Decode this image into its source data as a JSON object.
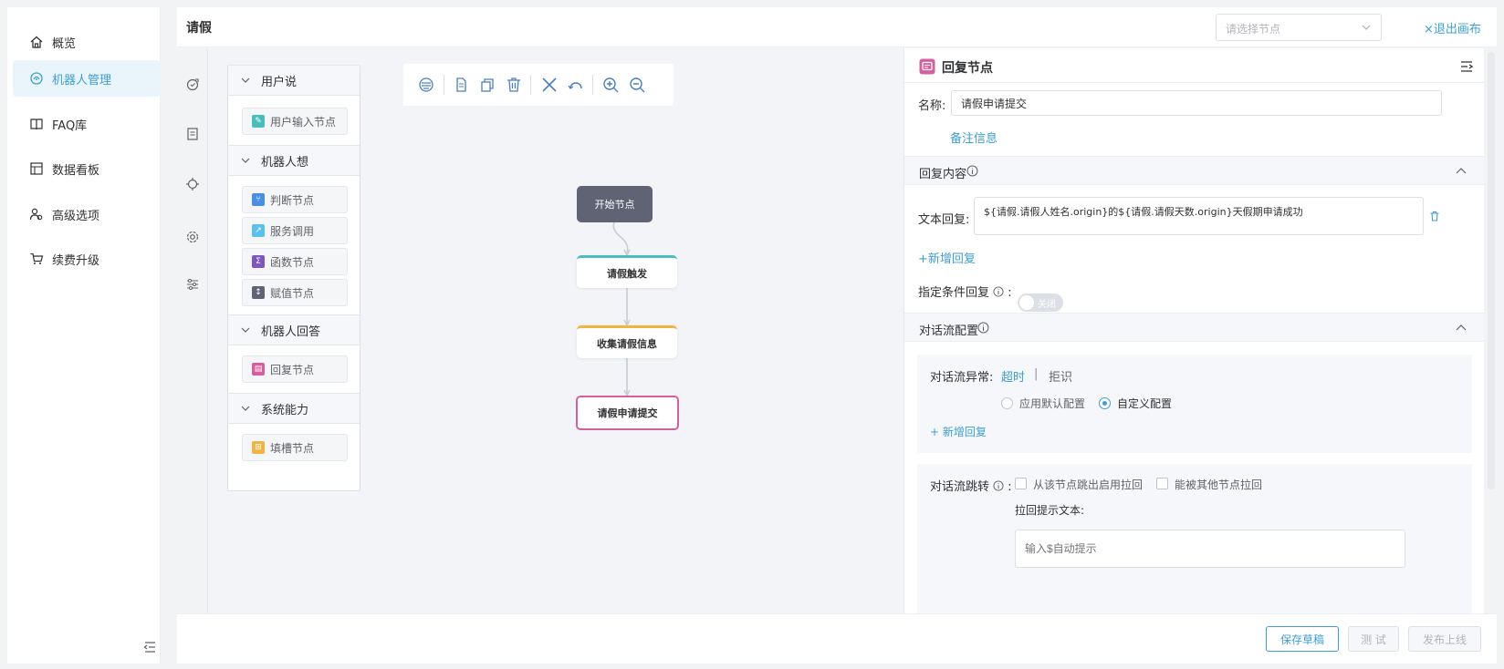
{
  "nav": {
    "items": [
      {
        "label": "概览",
        "icon": "home-icon"
      },
      {
        "label": "机器人管理",
        "icon": "robot-icon",
        "active": true
      },
      {
        "label": "FAQ库",
        "icon": "book-icon"
      },
      {
        "label": "数据看板",
        "icon": "dashboard-icon"
      },
      {
        "label": "高级选项",
        "icon": "users-icon"
      },
      {
        "label": "续费升级",
        "icon": "cart-icon"
      }
    ]
  },
  "topbar": {
    "title": "请假",
    "node_select_placeholder": "请选择节点",
    "exit_label": "×退出画布"
  },
  "palette": {
    "groups": [
      {
        "title": "用户说",
        "items": [
          {
            "label": "用户输入节点",
            "color": "#48bfbd"
          }
        ]
      },
      {
        "title": "机器人想",
        "items": [
          {
            "label": "判断节点",
            "color": "#4a90e2"
          },
          {
            "label": "服务调用",
            "color": "#5bc0eb"
          },
          {
            "label": "函数节点",
            "color": "#7e57c2"
          },
          {
            "label": "赋值节点",
            "color": "#5f6373"
          }
        ]
      },
      {
        "title": "机器人回答",
        "items": [
          {
            "label": "回复节点",
            "color": "#d6609f"
          }
        ]
      },
      {
        "title": "系统能力",
        "items": [
          {
            "label": "填槽节点",
            "color": "#f0b443"
          }
        ]
      }
    ]
  },
  "flow": {
    "nodes": {
      "start": "开始节点",
      "trigger": "请假触发",
      "collect": "收集请假信息",
      "submit": "请假申请提交"
    }
  },
  "panel": {
    "title": "回复节点",
    "name_label": "名称:",
    "name_value": "请假申请提交",
    "remark_link": "备注信息",
    "reply_section": "回复内容",
    "text_reply_label": "文本回复:",
    "text_reply_value": "${请假.请假人姓名.origin}的${请假.请假天数.origin}天假期申请成功",
    "add_reply": "+新增回复",
    "cond_reply_label": "指定条件回复",
    "cond_colon": ":",
    "toggle_text": "关闭",
    "flow_section": "对话流配置",
    "exception_label": "对话流异常:",
    "exception_tabs": [
      "超时",
      "|",
      "拒识"
    ],
    "radio_default": "应用默认配置",
    "radio_custom": "自定义配置",
    "add_reply2": "+ 新增回复",
    "jump_label": "对话流跳转",
    "jump_colon": ":",
    "check1": "从该节点跳出启用拉回",
    "check2": "能被其他节点拉回",
    "pullback_label": "拉回提示文本:",
    "pullback_placeholder": "输入$自动提示"
  },
  "footer": {
    "save": "保存草稿",
    "test": "测 试",
    "publish": "发布上线"
  }
}
